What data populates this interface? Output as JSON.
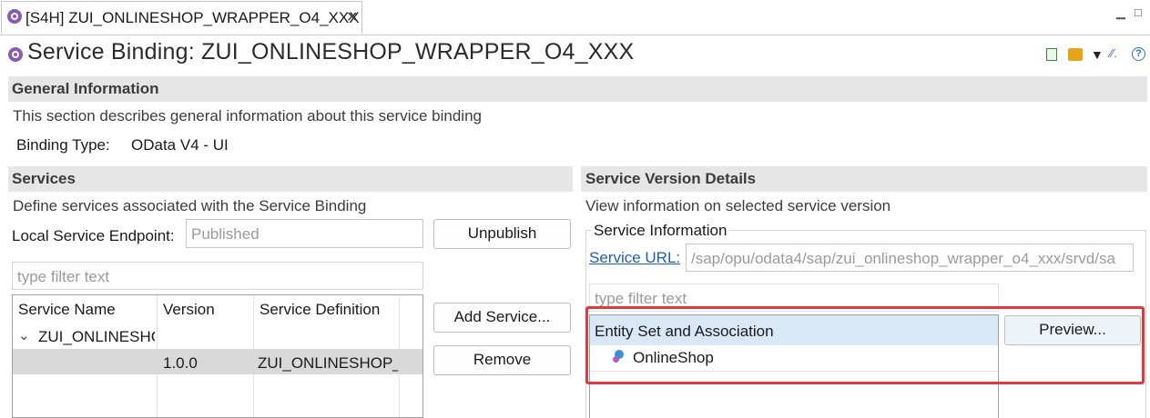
{
  "tab": {
    "title": "[S4H] ZUI_ONLINESHOP_WRAPPER_O4_XXX",
    "close": "✕"
  },
  "window_controls": {
    "minimize": "▁",
    "maximize": "□"
  },
  "editor": {
    "title": "Service Binding: ZUI_ONLINESHOP_WRAPPER_O4_XXX"
  },
  "general": {
    "title": "General Information",
    "description": "This section describes general information about this service binding",
    "binding_type_label": "Binding Type:",
    "binding_type_value": "OData V4 - UI"
  },
  "services": {
    "title": "Services",
    "description": "Define services associated with the Service Binding",
    "endpoint_label": "Local Service Endpoint:",
    "endpoint_value": "Published",
    "unpublish_label": "Unpublish",
    "filter_placeholder": "type filter text",
    "columns": [
      "Service Name",
      "Version",
      "Service Definition"
    ],
    "tree_root": "ZUI_ONLINESHC",
    "tree_child": {
      "version": "1.0.0",
      "definition": "ZUI_ONLINESHOP_\\"
    },
    "add_service_label": "Add Service...",
    "remove_label": "Remove"
  },
  "details": {
    "title": "Service Version Details",
    "description": "View information on selected service version",
    "info_group_label": "Service Information",
    "service_url_label": "Service URL:",
    "service_url_value": "/sap/opu/odata4/sap/zui_onlineshop_wrapper_o4_xxx/srvd/sa",
    "filter_placeholder": "type filter text",
    "entity_header": "Entity Set and Association",
    "entity_item": "OnlineShop",
    "preview_label": "Preview..."
  },
  "colors": {
    "accent_link": "#1a5fb4",
    "highlight": "#e03a3e",
    "selection": "#d9e8f6",
    "section_bar": "#e6e6e6"
  }
}
